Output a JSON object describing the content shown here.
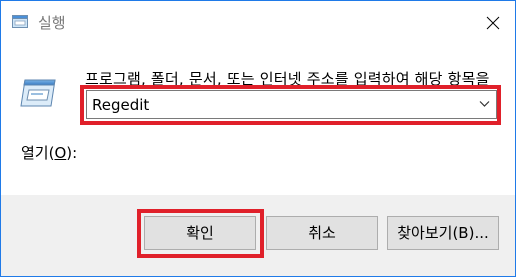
{
  "window": {
    "title": "실행",
    "close_icon": "close-icon"
  },
  "content": {
    "icon": "run-dialog-icon",
    "description": "프로그램, 폴더, 문서, 또는 인터넷 주소를 입력하여 해당 항목을 열 수 있습니다.",
    "open_label_prefix": "열기(",
    "open_label_accesskey": "O",
    "open_label_suffix": "):",
    "combo_value": "Regedit"
  },
  "buttons": {
    "ok": "확인",
    "cancel": "취소",
    "browse": "찾아보기(B)..."
  },
  "colors": {
    "highlight": "#e0202a",
    "window_border": "#1f7ae8",
    "footer_bg": "#f0f0f0"
  }
}
